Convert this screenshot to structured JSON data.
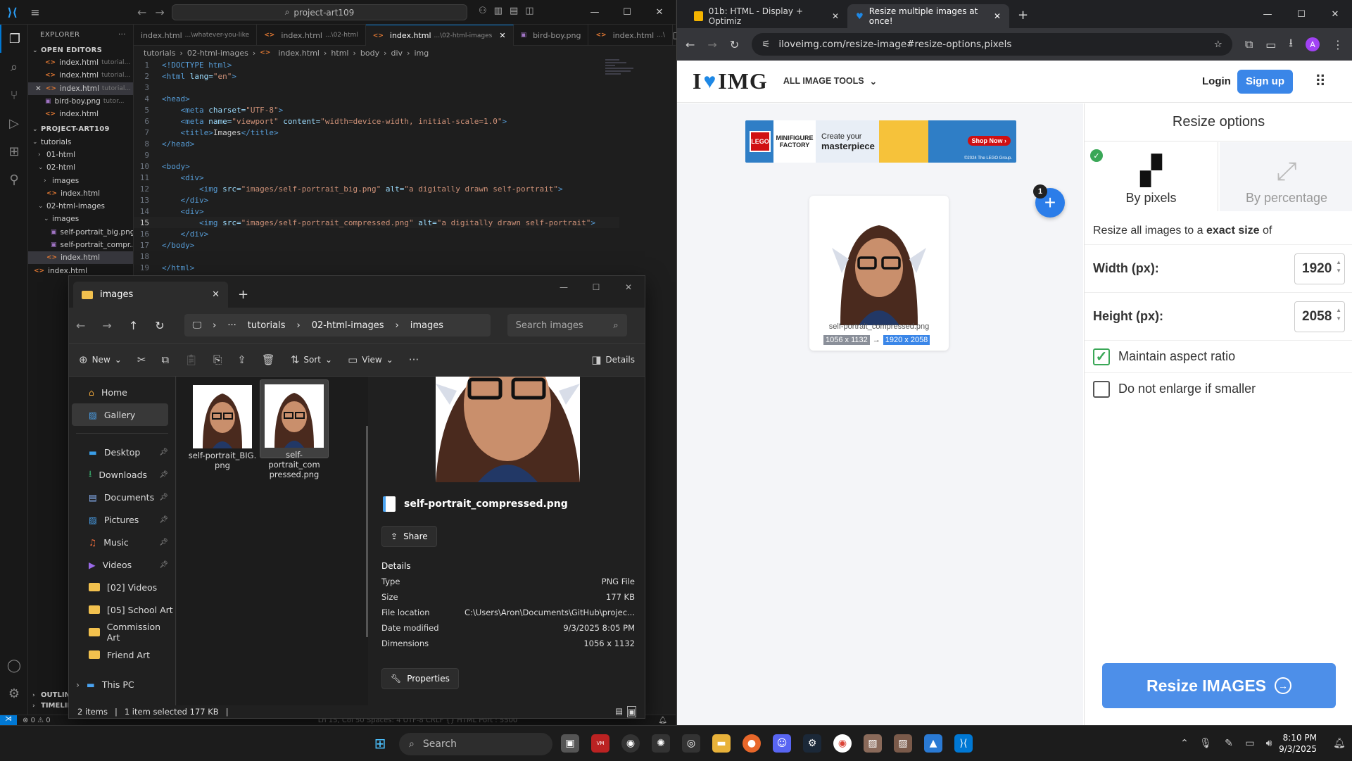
{
  "vscode": {
    "search_text": "project-art109",
    "explorer_label": "EXPLORER",
    "open_editors_label": "OPEN EDITORS",
    "open_editors": [
      {
        "name": "index.html",
        "hint": "tutorial..."
      },
      {
        "name": "index.html",
        "hint": "tutorial..."
      },
      {
        "name": "index.html",
        "hint": "tutorial..."
      },
      {
        "name": "bird-boy.png",
        "hint": "tutor..."
      },
      {
        "name": "index.html",
        "hint": ""
      }
    ],
    "project_label": "PROJECT-ART109",
    "tree": [
      {
        "label": "tutorials"
      },
      {
        "label": "01-html"
      },
      {
        "label": "02-html"
      },
      {
        "label": "images"
      },
      {
        "label": "index.html"
      },
      {
        "label": "02-html-images"
      },
      {
        "label": "images"
      },
      {
        "label": "self-portrait_big.png"
      },
      {
        "label": "self-portrait_compr..."
      },
      {
        "label": "index.html"
      },
      {
        "label": "index.html"
      }
    ],
    "outline_label": "OUTLINE",
    "timeline_label": "TIMELINE",
    "tabs": [
      {
        "label": "index.html",
        "hint": "...\\whatever-you-like"
      },
      {
        "label": "index.html",
        "hint": "...\\02-html"
      },
      {
        "label": "index.html",
        "hint": "...\\02-html-images"
      },
      {
        "label": "bird-boy.png",
        "hint": ""
      },
      {
        "label": "index.html",
        "hint": "...\\"
      }
    ],
    "breadcrumbs": [
      "tutorials",
      "02-html-images",
      "index.html",
      "html",
      "body",
      "div",
      "img"
    ],
    "line_numbers": [
      "1",
      "2",
      "3",
      "4",
      "5",
      "6",
      "7",
      "8",
      "9",
      "10",
      "11",
      "12",
      "13",
      "14",
      "15",
      "16",
      "17",
      "18",
      "19"
    ],
    "code": {
      "l1": "<!DOCTYPE html>",
      "l2a": "<html",
      "l2b": " lang=",
      "l2c": "\"en\"",
      "l2d": ">",
      "l4": "<head>",
      "l5a": "<meta",
      "l5b": " charset=",
      "l5c": "\"UTF-8\"",
      "l5d": ">",
      "l6a": "<meta",
      "l6b": " name=",
      "l6c": "\"viewport\"",
      "l6d": " content=",
      "l6e": "\"width=device-width, initial-scale=1.0\"",
      "l6f": ">",
      "l7a": "<title>",
      "l7b": "Images",
      "l7c": "</title>",
      "l8": "</head>",
      "l10": "<body>",
      "l11": "<div>",
      "l12a": "<img",
      "l12b": " src=",
      "l12c": "\"images/self-portrait_big.png\"",
      "l12d": " alt=",
      "l12e": "\"a digitally drawn self-portrait\"",
      "l12f": ">",
      "l13": "</div>",
      "l14": "<div>",
      "l15a": "<img",
      "l15b": " src=",
      "l15c": "\"images/self-portrait_compressed.png\"",
      "l15d": " alt=",
      "l15e": "\"a digitally drawn self-portrait\"",
      "l15f": ">",
      "l16": "</div>",
      "l17": "</body>",
      "l19": "</html>"
    },
    "status_errors": "0",
    "status_warnings": "0",
    "status_right": "Ln 15, Col 50    Spaces: 4    UTF-8    CRLF    {} HTML    Port : 5500"
  },
  "explorer": {
    "tab_title": "images",
    "path": [
      "tutorials",
      "02-html-images",
      "images"
    ],
    "search_placeholder": "Search images",
    "cmd_new": "New",
    "cmd_sort": "Sort",
    "cmd_view": "View",
    "cmd_details": "Details",
    "nav": [
      {
        "label": "Home",
        "pinned": false
      },
      {
        "label": "Gallery",
        "pinned": false
      },
      {
        "label": "Desktop",
        "pinned": true
      },
      {
        "label": "Downloads",
        "pinned": true
      },
      {
        "label": "Documents",
        "pinned": true
      },
      {
        "label": "Pictures",
        "pinned": true
      },
      {
        "label": "Music",
        "pinned": true
      },
      {
        "label": "Videos",
        "pinned": true
      },
      {
        "label": "[02] Videos",
        "pinned": false
      },
      {
        "label": "[05] School Art",
        "pinned": false
      },
      {
        "label": "Commission Art",
        "pinned": false
      },
      {
        "label": "Friend Art",
        "pinned": false
      },
      {
        "label": "This PC",
        "pinned": false
      }
    ],
    "files": [
      {
        "name": "self-portrait_BIG.png"
      },
      {
        "name": "self-portrait_compressed.png"
      }
    ],
    "file_name_1a": "self-portrait_BIG.",
    "file_name_1b": "png",
    "file_name_2a": "self-portrait_com",
    "file_name_2b": "pressed.png",
    "details_filename": "self-portrait_compressed.png",
    "share_label": "Share",
    "details_heading": "Details",
    "details": [
      {
        "key": "Type",
        "value": "PNG File"
      },
      {
        "key": "Size",
        "value": "177 KB"
      },
      {
        "key": "File location",
        "value": "C:\\Users\\Aron\\Documents\\GitHub\\projec..."
      },
      {
        "key": "Date modified",
        "value": "9/3/2025 8:05 PM"
      },
      {
        "key": "Dimensions",
        "value": "1056 x 1132"
      }
    ],
    "properties_label": "Properties",
    "status_items": "2 items",
    "status_selected": "1 item selected  177 KB"
  },
  "chrome": {
    "tabs": [
      {
        "label": "01b: HTML - Display + Optimiz"
      },
      {
        "label": "Resize multiple images at once!"
      }
    ],
    "url": "iloveimg.com/resize-image#resize-options,pixels",
    "profile_initial": "A"
  },
  "iloveimg": {
    "logo_left": "I",
    "logo_right": "IMG",
    "all_tools": "ALL IMAGE TOOLS",
    "login": "Login",
    "signup": "Sign up",
    "ad_brand": "LEGO",
    "ad_line1": "MINIFIGURE",
    "ad_line2": "FACTORY",
    "ad_headline1": "Create your",
    "ad_headline2": "masterpiece",
    "ad_cta": "Shop Now ›",
    "ad_fine": "©2024 The LEGO Group.",
    "file_count": "1",
    "card_filename": "self-portrait_compressed.png",
    "card_orig_size": "1056 x 1132",
    "card_new_size": "1920 x 2058",
    "panel_title": "Resize options",
    "opt_pixels": "By pixels",
    "opt_percentage": "By percentage",
    "resize_text_a": "Resize all images to a ",
    "resize_text_b": "exact size",
    "resize_text_c": " of",
    "width_label": "Width (px):",
    "width_value": "1920",
    "height_label": "Height (px):",
    "height_value": "2058",
    "maintain_label": "Maintain aspect ratio",
    "maintain_checked": true,
    "no_enlarge_label": "Do not enlarge if smaller",
    "no_enlarge_checked": false,
    "resize_button": "Resize IMAGES",
    "accent": "#3a86e8"
  },
  "taskbar": {
    "search_label": "Search",
    "time": "8:10 PM",
    "date": "9/3/2025"
  }
}
